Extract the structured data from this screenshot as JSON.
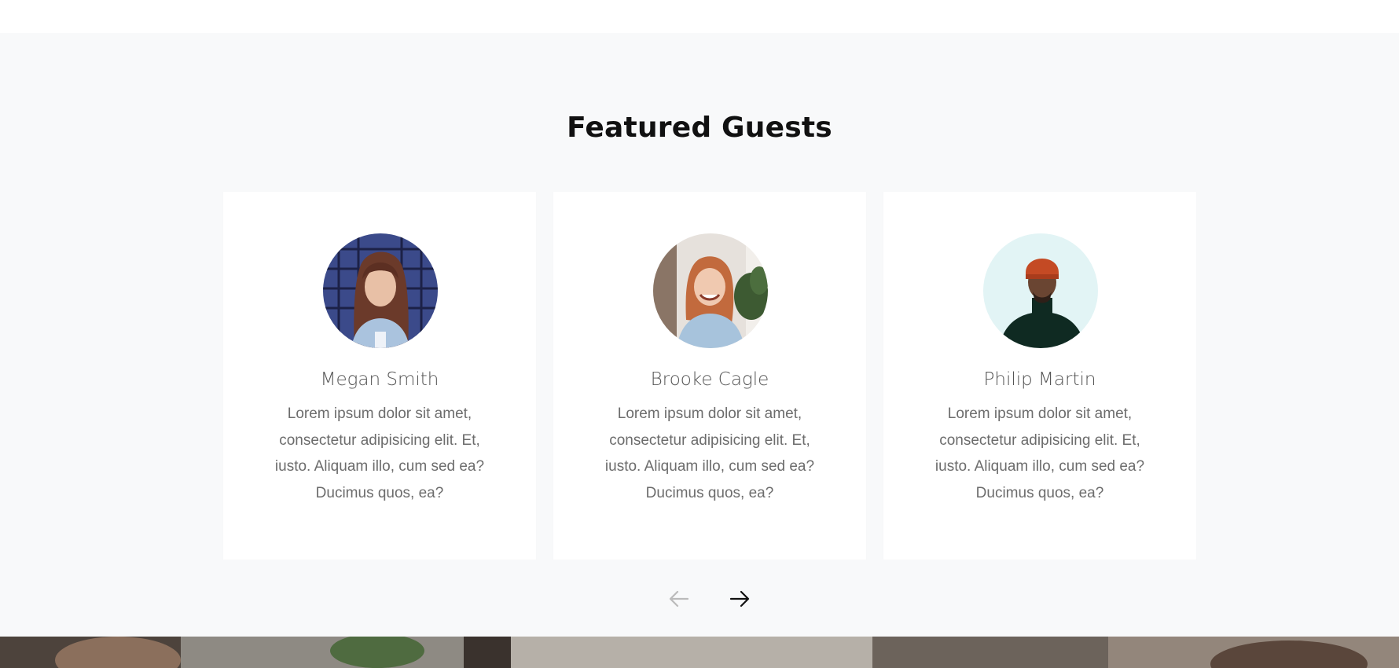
{
  "section": {
    "title": "Featured Guests"
  },
  "guests": [
    {
      "name": "Megan Smith",
      "bio": "Lorem ipsum dolor sit amet, consectetur adipisicing elit. Et, iusto. Aliquam illo, cum sed ea? Ducimus quos, ea?",
      "avatar": "photo-woman-brown-hair-blue-grid-background"
    },
    {
      "name": "Brooke Cagle",
      "bio": "Lorem ipsum dolor sit amet, consectetur adipisicing elit. Et, iusto. Aliquam illo, cum sed ea? Ducimus quos, ea?",
      "avatar": "photo-woman-smiling-denim-shirt-plant"
    },
    {
      "name": "Philip Martin",
      "bio": "Lorem ipsum dolor sit amet, consectetur adipisicing elit. Et, iusto. Aliquam illo, cum sed ea? Ducimus quos, ea?",
      "avatar": "photo-man-orange-beanie-black-turtleneck"
    }
  ],
  "carousel": {
    "prev_icon": "arrow-left-icon",
    "next_icon": "arrow-right-icon",
    "prev_enabled": false,
    "next_enabled": true
  },
  "colors": {
    "section_background": "#f8f9fa",
    "card_background": "#ffffff",
    "title": "#111111",
    "name": "#555555",
    "bio": "#6c6c6c",
    "arrow_active": "#111111",
    "arrow_disabled": "#bbbbbb"
  }
}
